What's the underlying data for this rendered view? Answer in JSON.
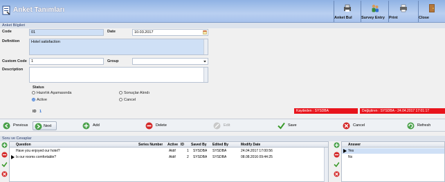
{
  "window": {
    "title": "Anket Tanımları"
  },
  "toolbar_top": [
    {
      "label": "Anket Bul",
      "icon": "printer-search-icon"
    },
    {
      "label": "Survey Entry",
      "icon": "users-icon"
    },
    {
      "label": "Print",
      "icon": "printer-icon"
    },
    {
      "label": "Close",
      "icon": "door-exit-icon"
    }
  ],
  "info_group": {
    "header": "Anket Bilgileri",
    "code_label": "Code",
    "code_value": "01",
    "date_label": "Date",
    "date_value": "10.03.2017",
    "definition_label": "Definition",
    "definition_value": "Hotel satisfaction",
    "custom_code_label": "Custom Code",
    "custom_code_value": "1",
    "group_label": "Group",
    "group_value": "",
    "description_label": "Description",
    "description_value": ""
  },
  "status": {
    "label": "Status",
    "options": [
      {
        "label": "Hazırlık Aşamasında",
        "selected": false
      },
      {
        "label": "Sonuçlar Alındı",
        "selected": false
      },
      {
        "label": "Active",
        "selected": true
      },
      {
        "label": "Cancel",
        "selected": false
      }
    ],
    "id_label": "ID",
    "id_value": "1",
    "created_by": "Kaydeden : SYSDBA",
    "modified_by": "Değiştiren : SYSDBA - 24.04.2017 17:01:17"
  },
  "actions": [
    {
      "label": "Previous",
      "icon": "arrow-left-icon"
    },
    {
      "label": "Next",
      "icon": "arrow-right-icon"
    },
    {
      "label": "Add",
      "icon": "plus-icon"
    },
    {
      "label": "Delete",
      "icon": "minus-icon"
    },
    {
      "label": "Edit",
      "icon": "edit-icon"
    },
    {
      "label": "Save",
      "icon": "checkmark-icon"
    },
    {
      "label": "Cancel",
      "icon": "cancel-icon"
    },
    {
      "label": "Refresh",
      "icon": "refresh-icon"
    }
  ],
  "questions_section": {
    "header": "Soru ve Cevaplar",
    "columns": [
      "Question",
      "Series Number",
      "Active",
      "ID",
      "Saved By",
      "Edited By",
      "Modify Date"
    ],
    "rows": [
      [
        "Have you enjoyed our hotel?",
        "",
        "Aktif",
        "1",
        "SYSDBA",
        "SYSDBA",
        "24.04.2017 17:00:56"
      ],
      [
        "Is our rooms comfortable?",
        "",
        "Aktif",
        "2",
        "SYSDBA",
        "SYSDBA",
        "08.08.2016 09:44:25"
      ]
    ]
  },
  "answers": {
    "header": "Answer",
    "rows": [
      "Yes",
      "No"
    ]
  },
  "colors": {
    "accent": "#2f6fd0",
    "danger": "#e8141c",
    "titlebar": "#a7c2ec"
  }
}
